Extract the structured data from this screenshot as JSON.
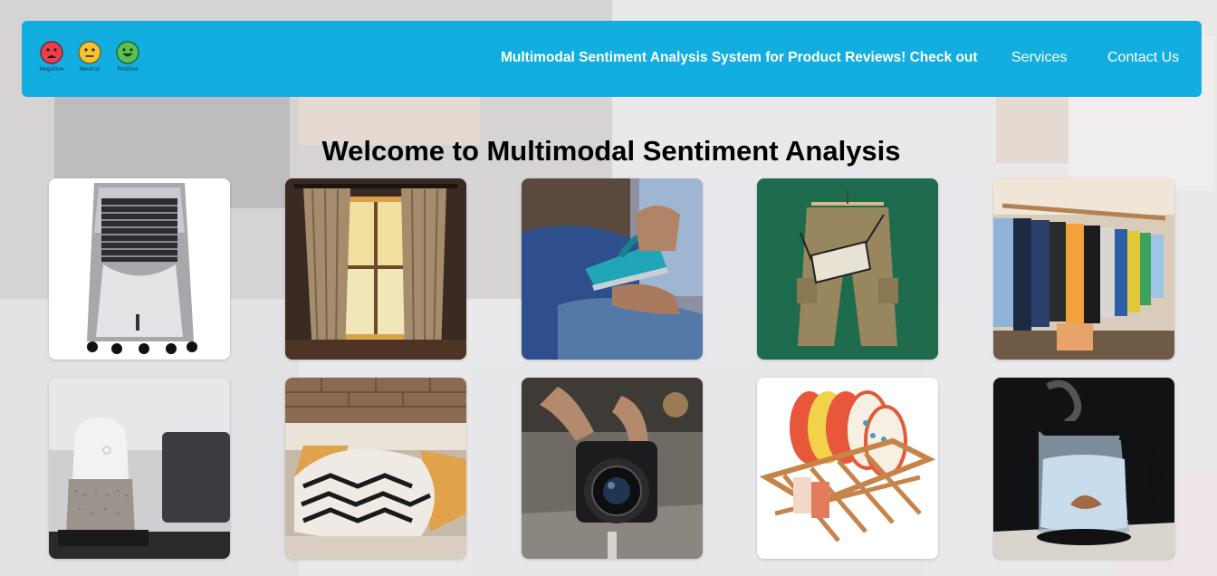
{
  "navbar": {
    "logo": {
      "faces": [
        {
          "label": "Negative",
          "color": "#e8414b",
          "mood": "negative"
        },
        {
          "label": "Neutral",
          "color": "#f3c332",
          "mood": "neutral"
        },
        {
          "label": "Positive",
          "color": "#5cbf52",
          "mood": "positive"
        }
      ]
    },
    "title_link": "Multimodal Sentiment Analysis System for Product Reviews! Check out",
    "services_link": "Services",
    "contact_link": "Contact Us",
    "background_color": "#13aee0"
  },
  "main": {
    "heading": "Welcome to Multimodal Sentiment Analysis",
    "products": [
      {
        "name": "air-cooler"
      },
      {
        "name": "curtains"
      },
      {
        "name": "steam-iron"
      },
      {
        "name": "cargo-pants"
      },
      {
        "name": "clothing-rack"
      },
      {
        "name": "smart-speaker"
      },
      {
        "name": "cushion"
      },
      {
        "name": "camera"
      },
      {
        "name": "dish-rack"
      },
      {
        "name": "electric-kettle"
      }
    ]
  }
}
